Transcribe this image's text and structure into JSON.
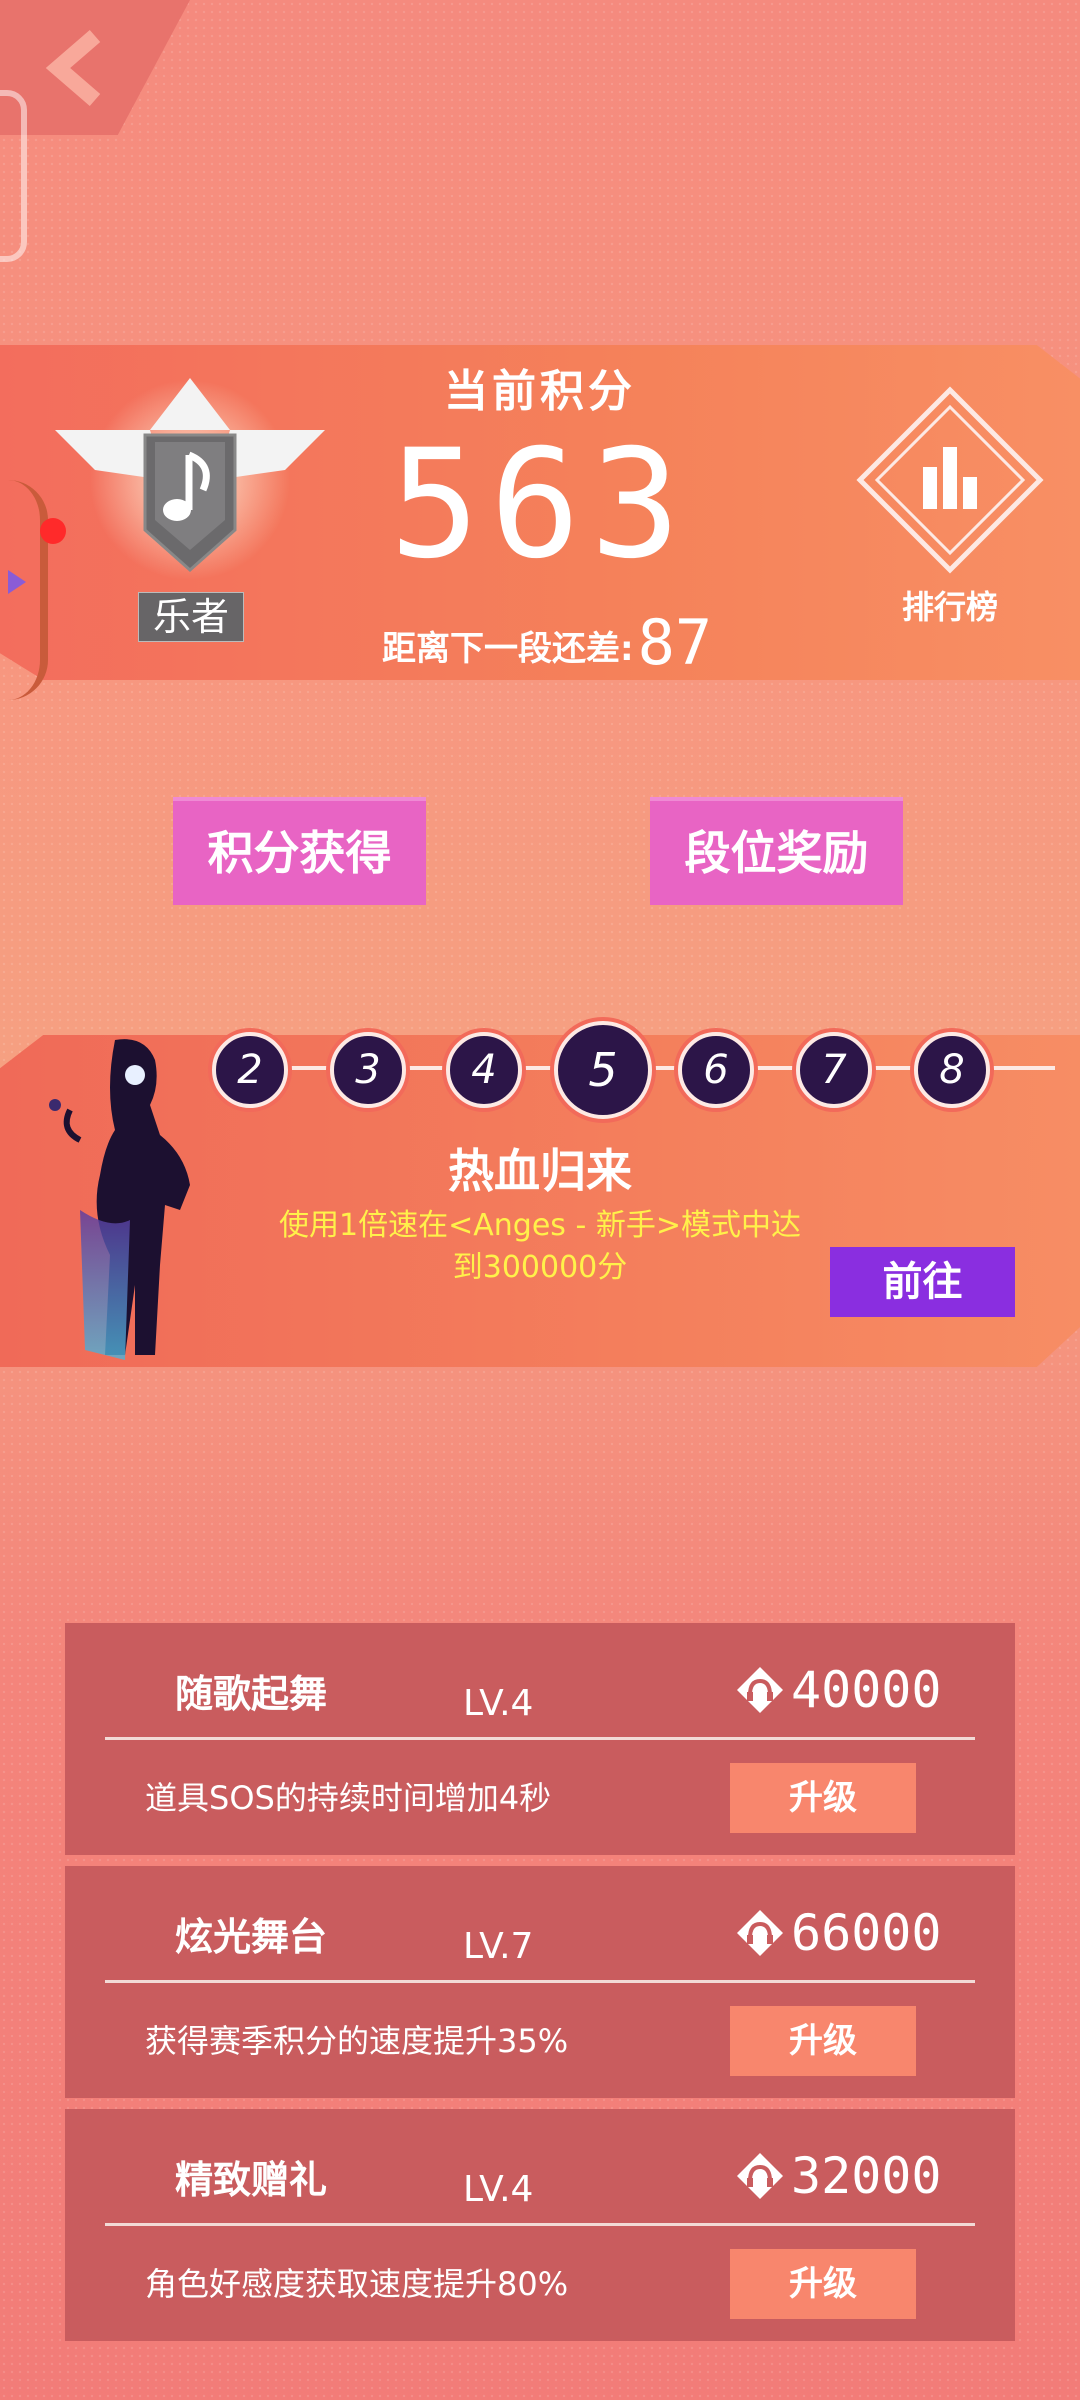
{
  "header": {
    "back_label": "back"
  },
  "points": {
    "title": "当前积分",
    "value": "563",
    "next_label": "距离下一段还差:",
    "next_value": "87"
  },
  "rank": {
    "label": "乐者"
  },
  "leaderboard": {
    "label": "排行榜"
  },
  "buttons": {
    "earn_points": "积分获得",
    "rank_rewards": "段位奖励"
  },
  "levels": [
    "2",
    "3",
    "4",
    "5",
    "6",
    "7",
    "8"
  ],
  "active_level": "5",
  "task": {
    "title": "热血归来",
    "desc_line1": "使用1倍速在<Anges - 新手>模式中达",
    "desc_line2": "到300000分",
    "go_label": "前往"
  },
  "skills": [
    {
      "name": "随歌起舞",
      "level": "LV.4",
      "cost": "40000",
      "desc": "道具SOS的持续时间增加4秒",
      "button": "升级"
    },
    {
      "name": "炫光舞台",
      "level": "LV.7",
      "cost": "66000",
      "desc": "获得赛季积分的速度提升35%",
      "button": "升级"
    },
    {
      "name": "精致赠礼",
      "level": "LV.4",
      "cost": "32000",
      "desc": "角色好感度获取速度提升80%",
      "button": "升级"
    }
  ],
  "colors": {
    "accent_pink": "#e864c4",
    "accent_purple": "#8a2ee0",
    "level_dark": "#2c1548",
    "task_text": "#fff14a",
    "card_bg": "#c95c5e",
    "upgrade_btn": "#f8866d"
  },
  "icons": [
    "back-chevron-icon",
    "music-note-emblem-icon",
    "leaderboard-bars-icon",
    "diamond-currency-icon"
  ]
}
